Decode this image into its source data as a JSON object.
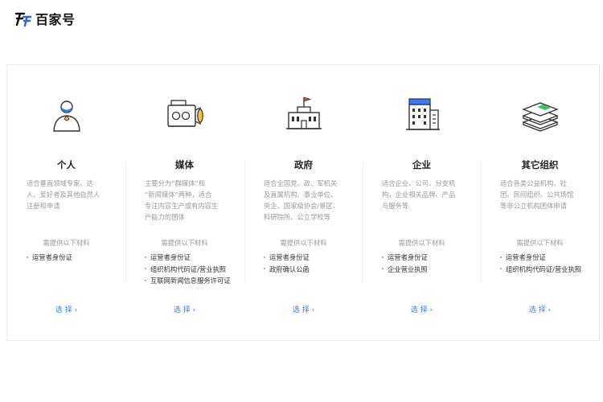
{
  "brand": {
    "name": "百家号"
  },
  "colors": {
    "accent": "#3b7cf6",
    "brand_blue": "#2a64e0"
  },
  "columns": [
    {
      "key": "personal",
      "icon": "person-icon",
      "title": "个人",
      "desc": [
        "适合垂直领域专家、达",
        "人、爱好者及其他自然人",
        "注册和申请"
      ],
      "req": "需提供以下材料",
      "materials": [
        "运营者身份证"
      ],
      "select": "选 择 ›"
    },
    {
      "key": "media",
      "icon": "camera-icon",
      "title": "媒体",
      "desc": [
        "主要分为“群媒体”和",
        "“新闻媒体”两种，适合",
        "专注内容生产或有内容生",
        "产能力的团体"
      ],
      "req": "需提供以下材料",
      "materials": [
        "运营者身份证",
        "组织机构代码证/营业执照",
        "互联网新闻信息服务许可证"
      ],
      "select": "选 择 ›"
    },
    {
      "key": "government",
      "icon": "government-building-icon",
      "title": "政府",
      "desc": [
        "适合全国党、政、军机关",
        "及直属机构、事业单位、",
        "央企、国家级协会/景区、",
        "科研院所、公立学校等"
      ],
      "req": "需提供以下材料",
      "materials": [
        "运营者身份证",
        "政府确认公函"
      ],
      "select": "选 择 ›"
    },
    {
      "key": "enterprise",
      "icon": "office-building-icon",
      "title": "企业",
      "desc": [
        "适合企业、公司、分支机",
        "构，企业相关品牌、产品",
        "与服务等"
      ],
      "req": "需提供以下材料",
      "materials": [
        "运营者身份证",
        "企业营业执照"
      ],
      "select": "选 择 ›"
    },
    {
      "key": "other",
      "icon": "stacked-layers-icon",
      "title": "其它组织",
      "desc": [
        "适合各类公益机构、社",
        "团、民间组织、公共场馆",
        "等非公立机构团体申请"
      ],
      "req": "需提供以下材料",
      "materials": [
        "运营者身份证",
        "组织机构代码证/营业执照"
      ],
      "select": "选 择 ›"
    }
  ]
}
